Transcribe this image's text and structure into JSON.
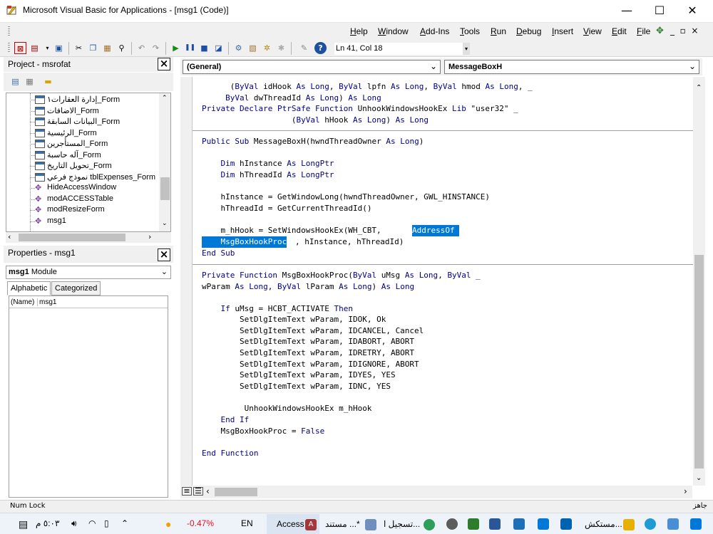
{
  "window": {
    "title": "Microsoft Visual Basic for Applications - [msg1 (Code)]",
    "minimize": "—",
    "maximize": "☐",
    "close": "✕"
  },
  "menu": {
    "items": [
      "Help",
      "Window",
      "Add-Ins",
      "Tools",
      "Run",
      "Debug",
      "Insert",
      "View",
      "Edit",
      "File"
    ],
    "mdi_controls": "_  ▫  ×"
  },
  "toolbar": {
    "position": "Ln 41, Col 18"
  },
  "project": {
    "title": "Project - msrofat",
    "items": [
      {
        "label": "إدارة العقارات١_Form",
        "type": "form"
      },
      {
        "label": "الاضافات_Form",
        "type": "form"
      },
      {
        "label": "البيانات السابقة_Form",
        "type": "form"
      },
      {
        "label": "الرئيسية_Form",
        "type": "form"
      },
      {
        "label": "المستأجرين_Form",
        "type": "form"
      },
      {
        "label": "آله حاسبة_Form",
        "type": "form"
      },
      {
        "label": "تحويل التاريخ_Form",
        "type": "form"
      },
      {
        "label": "نموذج فرعي tblExpenses_Form",
        "type": "form"
      },
      {
        "label": "HideAccessWindow",
        "type": "module"
      },
      {
        "label": "modACCESSTable",
        "type": "module"
      },
      {
        "label": "modResizeForm",
        "type": "module"
      },
      {
        "label": "msg1",
        "type": "module"
      }
    ]
  },
  "properties": {
    "title": "Properties - msg1",
    "object_name": "msg1",
    "object_type": "Module",
    "tab_alphabetic": "Alphabetic",
    "tab_categorized": "Categorized",
    "row_name": "(Name)",
    "row_value": "msg1"
  },
  "code": {
    "object_combo": "(General)",
    "proc_combo": "MessageBoxH",
    "lines": [
      {
        "t": "      (ByVal idHook As Long, ByVal lpfn As Long, ByVal hmod As Long, _"
      },
      {
        "t": "     ByVal dwThreadId As Long) As Long"
      },
      {
        "t": "Private Declare PtrSafe Function UnhookWindowsHookEx Lib \"user32\" _"
      },
      {
        "t": "                   (ByVal hHook As Long) As Long"
      },
      {
        "t": "Public Sub MessageBoxH(hwndThreadOwner As Long)"
      },
      {
        "t": "    Dim hInstance As LongPtr"
      },
      {
        "t": "    Dim hThreadId As LongPtr"
      },
      {
        "t": "    hInstance = GetWindowLong(hwndThreadOwner, GWL_HINSTANCE)"
      },
      {
        "t": "    hThreadId = GetCurrentThreadId()"
      },
      {
        "t": "    m_hHook = SetWindowsHookEx(WH_CBT, "
      },
      {
        "t": "AddressOf "
      },
      {
        "t": "    MsgBoxHookProc"
      },
      {
        "t": ", hInstance, hThreadId)"
      },
      {
        "t": "End Sub"
      },
      {
        "t": "Private Function MsgBoxHookProc(ByVal uMsg As Long, ByVal _"
      },
      {
        "t": "wParam As Long, ByVal lParam As Long) As Long"
      },
      {
        "t": "    If uMsg = HCBT_ACTIVATE Then"
      },
      {
        "t": "        SetDlgItemText wParam, IDOK, Ok"
      },
      {
        "t": "        SetDlgItemText wParam, IDCANCEL, Cancel"
      },
      {
        "t": "        SetDlgItemText wParam, IDABORT, ABORT"
      },
      {
        "t": "        SetDlgItemText wParam, IDRETRY, ABORT"
      },
      {
        "t": "        SetDlgItemText wParam, IDIGNORE, ABORT"
      },
      {
        "t": "        SetDlgItemText wParam, IDYES, YES"
      },
      {
        "t": "        SetDlgItemText wParam, IDNC, YES"
      },
      {
        "t": "         UnhookWindowsHookEx m_hHook"
      },
      {
        "t": "    End If"
      },
      {
        "t": "    MsgBoxHookProc = False"
      },
      {
        "t": "End Function"
      }
    ]
  },
  "status": {
    "left": "Num Lock",
    "right": "جاهز"
  },
  "taskbar": {
    "time": "٥:٠٣ م",
    "stock": "-0.47%",
    "lang": "EN",
    "apps": [
      "Access",
      "مستند ...*",
      "تسجيل ا...",
      "مستكش..."
    ]
  },
  "colors": {
    "keyword": "#00008b",
    "selection": "#0078d7",
    "stock_down": "#e81123"
  }
}
